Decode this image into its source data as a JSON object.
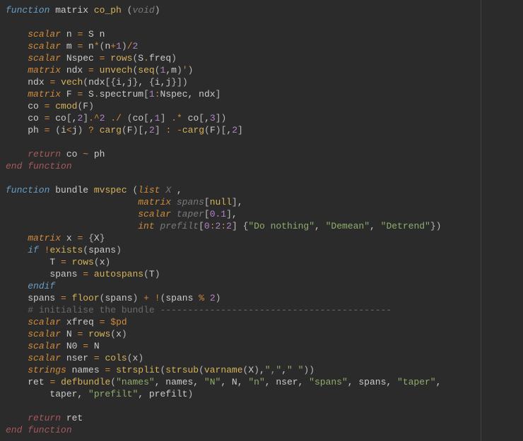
{
  "code": {
    "lines": [
      [
        [
          "kw-blue",
          "function"
        ],
        [
          "ident",
          " matrix "
        ],
        [
          "fn-name",
          "co_ph"
        ],
        [
          "ident",
          " "
        ],
        [
          "paren",
          "("
        ],
        [
          "void",
          "void"
        ],
        [
          "paren",
          ")"
        ]
      ],
      [],
      [
        [
          "ws",
          "    "
        ],
        [
          "type",
          "scalar"
        ],
        [
          "ident",
          " n "
        ],
        [
          "op-eq",
          "="
        ],
        [
          "ident",
          " S n"
        ]
      ],
      [
        [
          "ws",
          "    "
        ],
        [
          "type",
          "scalar"
        ],
        [
          "ident",
          " m "
        ],
        [
          "op-eq",
          "="
        ],
        [
          "ident",
          " n"
        ],
        [
          "op-dot",
          "*"
        ],
        [
          "paren",
          "("
        ],
        [
          "ident",
          "n"
        ],
        [
          "op-dot",
          "+"
        ],
        [
          "num",
          "1"
        ],
        [
          "paren",
          ")"
        ],
        [
          "op-dot",
          "/"
        ],
        [
          "num",
          "2"
        ]
      ],
      [
        [
          "ws",
          "    "
        ],
        [
          "type",
          "scalar"
        ],
        [
          "ident",
          " Nspec "
        ],
        [
          "op-eq",
          "="
        ],
        [
          "ident",
          " "
        ],
        [
          "call",
          "rows"
        ],
        [
          "paren",
          "("
        ],
        [
          "ident",
          "S"
        ],
        [
          "op-dot",
          "."
        ],
        [
          "prop",
          "freq"
        ],
        [
          "paren",
          ")"
        ]
      ],
      [
        [
          "ws",
          "    "
        ],
        [
          "type",
          "matrix"
        ],
        [
          "ident",
          " ndx "
        ],
        [
          "op-eq",
          "="
        ],
        [
          "ident",
          " "
        ],
        [
          "call",
          "unvech"
        ],
        [
          "paren",
          "("
        ],
        [
          "call",
          "seq"
        ],
        [
          "paren",
          "("
        ],
        [
          "num",
          "1"
        ],
        [
          "ident",
          ","
        ],
        [
          "ident",
          "m"
        ],
        [
          "paren",
          ")"
        ],
        [
          "op-dot",
          "'"
        ],
        [
          "paren",
          ")"
        ]
      ],
      [
        [
          "ws",
          "    "
        ],
        [
          "ident",
          "ndx "
        ],
        [
          "op-eq",
          "="
        ],
        [
          "ident",
          " "
        ],
        [
          "call",
          "vech"
        ],
        [
          "paren",
          "("
        ],
        [
          "ident",
          "ndx"
        ],
        [
          "brkt",
          "["
        ],
        [
          "brace",
          "{"
        ],
        [
          "ident",
          "i"
        ],
        [
          "ident",
          ","
        ],
        [
          "ident",
          "j"
        ],
        [
          "brace",
          "}"
        ],
        [
          "ident",
          ", "
        ],
        [
          "brace",
          "{"
        ],
        [
          "ident",
          "i"
        ],
        [
          "ident",
          ","
        ],
        [
          "ident",
          "j"
        ],
        [
          "brace",
          "}"
        ],
        [
          "brkt",
          "]"
        ],
        [
          "paren",
          ")"
        ]
      ],
      [
        [
          "ws",
          "    "
        ],
        [
          "type",
          "matrix"
        ],
        [
          "ident",
          " F "
        ],
        [
          "op-eq",
          "="
        ],
        [
          "ident",
          " S"
        ],
        [
          "op-dot",
          "."
        ],
        [
          "prop",
          "spectrum"
        ],
        [
          "brkt",
          "["
        ],
        [
          "num",
          "1"
        ],
        [
          "op-dot",
          ":"
        ],
        [
          "ident",
          "Nspec"
        ],
        [
          "ident",
          ", ndx"
        ],
        [
          "brkt",
          "]"
        ]
      ],
      [
        [
          "ws",
          "    "
        ],
        [
          "ident",
          "co "
        ],
        [
          "op-eq",
          "="
        ],
        [
          "ident",
          " "
        ],
        [
          "call",
          "cmod"
        ],
        [
          "paren",
          "("
        ],
        [
          "ident",
          "F"
        ],
        [
          "paren",
          ")"
        ]
      ],
      [
        [
          "ws",
          "    "
        ],
        [
          "ident",
          "co "
        ],
        [
          "op-eq",
          "="
        ],
        [
          "ident",
          " co"
        ],
        [
          "brkt",
          "["
        ],
        [
          "ident",
          ","
        ],
        [
          "num",
          "2"
        ],
        [
          "brkt",
          "]"
        ],
        [
          "op-dot",
          ".^"
        ],
        [
          "num",
          "2"
        ],
        [
          "ident",
          " "
        ],
        [
          "op-dot",
          "./"
        ],
        [
          "ident",
          " "
        ],
        [
          "paren",
          "("
        ],
        [
          "ident",
          "co"
        ],
        [
          "brkt",
          "["
        ],
        [
          "ident",
          ","
        ],
        [
          "num",
          "1"
        ],
        [
          "brkt",
          "]"
        ],
        [
          "ident",
          " "
        ],
        [
          "op-dot",
          ".*"
        ],
        [
          "ident",
          " co"
        ],
        [
          "brkt",
          "["
        ],
        [
          "ident",
          ","
        ],
        [
          "num",
          "3"
        ],
        [
          "brkt",
          "]"
        ],
        [
          "paren",
          ")"
        ]
      ],
      [
        [
          "ws",
          "    "
        ],
        [
          "ident",
          "ph "
        ],
        [
          "op-eq",
          "="
        ],
        [
          "ident",
          " "
        ],
        [
          "paren",
          "("
        ],
        [
          "ident",
          "i"
        ],
        [
          "op-dot",
          "<"
        ],
        [
          "ident",
          "j"
        ],
        [
          "paren",
          ")"
        ],
        [
          "ident",
          " "
        ],
        [
          "op-dot",
          "?"
        ],
        [
          "ident",
          " "
        ],
        [
          "call",
          "carg"
        ],
        [
          "paren",
          "("
        ],
        [
          "ident",
          "F"
        ],
        [
          "paren",
          ")"
        ],
        [
          "brkt",
          "["
        ],
        [
          "ident",
          ","
        ],
        [
          "num",
          "2"
        ],
        [
          "brkt",
          "]"
        ],
        [
          "ident",
          " "
        ],
        [
          "op-dot",
          ":"
        ],
        [
          "ident",
          " "
        ],
        [
          "op-dot",
          "-"
        ],
        [
          "call",
          "carg"
        ],
        [
          "paren",
          "("
        ],
        [
          "ident",
          "F"
        ],
        [
          "paren",
          ")"
        ],
        [
          "brkt",
          "["
        ],
        [
          "ident",
          ","
        ],
        [
          "num",
          "2"
        ],
        [
          "brkt",
          "]"
        ]
      ],
      [],
      [
        [
          "ws",
          "    "
        ],
        [
          "kw-retend",
          "return"
        ],
        [
          "ident",
          " co "
        ],
        [
          "op-dot",
          "~"
        ],
        [
          "ident",
          " ph"
        ]
      ],
      [
        [
          "kw-retend",
          "end function"
        ]
      ],
      [],
      [
        [
          "kw-blue",
          "function"
        ],
        [
          "ident",
          " bundle "
        ],
        [
          "fn-name",
          "mvspec"
        ],
        [
          "ident",
          " "
        ],
        [
          "paren",
          "("
        ],
        [
          "type",
          "list"
        ],
        [
          "ident",
          " "
        ],
        [
          "void",
          "X"
        ],
        [
          "ident",
          " ,"
        ]
      ],
      [
        [
          "ws",
          "                        "
        ],
        [
          "type",
          "matrix"
        ],
        [
          "ident",
          " "
        ],
        [
          "void",
          "spans"
        ],
        [
          "brkt",
          "["
        ],
        [
          "fn-name",
          "null"
        ],
        [
          "brkt",
          "]"
        ],
        [
          "ident",
          ","
        ]
      ],
      [
        [
          "ws",
          "                        "
        ],
        [
          "type",
          "scalar"
        ],
        [
          "ident",
          " "
        ],
        [
          "void",
          "taper"
        ],
        [
          "brkt",
          "["
        ],
        [
          "num",
          "0.1"
        ],
        [
          "brkt",
          "]"
        ],
        [
          "ident",
          ","
        ]
      ],
      [
        [
          "ws",
          "                        "
        ],
        [
          "type",
          "int"
        ],
        [
          "ident",
          " "
        ],
        [
          "void",
          "prefilt"
        ],
        [
          "brkt",
          "["
        ],
        [
          "num",
          "0"
        ],
        [
          "op-dot",
          ":"
        ],
        [
          "num",
          "2"
        ],
        [
          "op-dot",
          ":"
        ],
        [
          "num",
          "2"
        ],
        [
          "brkt",
          "]"
        ],
        [
          "ident",
          " "
        ],
        [
          "brace",
          "{"
        ],
        [
          "str",
          "\"Do nothing\""
        ],
        [
          "ident",
          ", "
        ],
        [
          "str",
          "\"Demean\""
        ],
        [
          "ident",
          ", "
        ],
        [
          "str",
          "\"Detrend\""
        ],
        [
          "brace",
          "}"
        ],
        [
          "paren",
          ")"
        ]
      ],
      [
        [
          "ws",
          "    "
        ],
        [
          "type",
          "matrix"
        ],
        [
          "ident",
          " x "
        ],
        [
          "op-eq",
          "="
        ],
        [
          "ident",
          " "
        ],
        [
          "brace",
          "{"
        ],
        [
          "ident",
          "X"
        ],
        [
          "brace",
          "}"
        ]
      ],
      [
        [
          "ws",
          "    "
        ],
        [
          "kw-blue",
          "if"
        ],
        [
          "ident",
          " "
        ],
        [
          "op-dot",
          "!"
        ],
        [
          "call",
          "exists"
        ],
        [
          "paren",
          "("
        ],
        [
          "ident",
          "spans"
        ],
        [
          "paren",
          ")"
        ]
      ],
      [
        [
          "ws",
          "        "
        ],
        [
          "ident",
          "T "
        ],
        [
          "op-eq",
          "="
        ],
        [
          "ident",
          " "
        ],
        [
          "call",
          "rows"
        ],
        [
          "paren",
          "("
        ],
        [
          "ident",
          "x"
        ],
        [
          "paren",
          ")"
        ]
      ],
      [
        [
          "ws",
          "        "
        ],
        [
          "ident",
          "spans "
        ],
        [
          "op-eq",
          "="
        ],
        [
          "ident",
          " "
        ],
        [
          "call",
          "autospans"
        ],
        [
          "paren",
          "("
        ],
        [
          "ident",
          "T"
        ],
        [
          "paren",
          ")"
        ]
      ],
      [
        [
          "ws",
          "    "
        ],
        [
          "kw-blue",
          "endif"
        ]
      ],
      [
        [
          "ws",
          "    "
        ],
        [
          "ident",
          "spans "
        ],
        [
          "op-eq",
          "="
        ],
        [
          "ident",
          " "
        ],
        [
          "call",
          "floor"
        ],
        [
          "paren",
          "("
        ],
        [
          "ident",
          "spans"
        ],
        [
          "paren",
          ")"
        ],
        [
          "ident",
          " "
        ],
        [
          "op-dot",
          "+"
        ],
        [
          "ident",
          " "
        ],
        [
          "op-dot",
          "!"
        ],
        [
          "paren",
          "("
        ],
        [
          "ident",
          "spans "
        ],
        [
          "op-dot",
          "%"
        ],
        [
          "ident",
          " "
        ],
        [
          "num",
          "2"
        ],
        [
          "paren",
          ")"
        ]
      ],
      [
        [
          "ws",
          "    "
        ],
        [
          "comment",
          "# initialise the bundle ------------------------------------------"
        ]
      ],
      [
        [
          "ws",
          "    "
        ],
        [
          "type",
          "scalar"
        ],
        [
          "ident",
          " xfreq "
        ],
        [
          "op-eq",
          "="
        ],
        [
          "ident",
          " "
        ],
        [
          "dollar",
          "$pd"
        ]
      ],
      [
        [
          "ws",
          "    "
        ],
        [
          "type",
          "scalar"
        ],
        [
          "ident",
          " N "
        ],
        [
          "op-eq",
          "="
        ],
        [
          "ident",
          " "
        ],
        [
          "call",
          "rows"
        ],
        [
          "paren",
          "("
        ],
        [
          "ident",
          "x"
        ],
        [
          "paren",
          ")"
        ]
      ],
      [
        [
          "ws",
          "    "
        ],
        [
          "type",
          "scalar"
        ],
        [
          "ident",
          " N0 "
        ],
        [
          "op-eq",
          "="
        ],
        [
          "ident",
          " N"
        ]
      ],
      [
        [
          "ws",
          "    "
        ],
        [
          "type",
          "scalar"
        ],
        [
          "ident",
          " nser "
        ],
        [
          "op-eq",
          "="
        ],
        [
          "ident",
          " "
        ],
        [
          "call",
          "cols"
        ],
        [
          "paren",
          "("
        ],
        [
          "ident",
          "x"
        ],
        [
          "paren",
          ")"
        ]
      ],
      [
        [
          "ws",
          "    "
        ],
        [
          "type",
          "strings"
        ],
        [
          "ident",
          " names "
        ],
        [
          "op-eq",
          "="
        ],
        [
          "ident",
          " "
        ],
        [
          "call",
          "strsplit"
        ],
        [
          "paren",
          "("
        ],
        [
          "call",
          "strsub"
        ],
        [
          "paren",
          "("
        ],
        [
          "call",
          "varname"
        ],
        [
          "paren",
          "("
        ],
        [
          "ident",
          "X"
        ],
        [
          "paren",
          ")"
        ],
        [
          "ident",
          ","
        ],
        [
          "str",
          "\",\""
        ],
        [
          "ident",
          ","
        ],
        [
          "str",
          "\" \""
        ],
        [
          "paren",
          "))"
        ]
      ],
      [
        [
          "ws",
          "    "
        ],
        [
          "ident",
          "ret "
        ],
        [
          "op-eq",
          "="
        ],
        [
          "ident",
          " "
        ],
        [
          "call",
          "defbundle"
        ],
        [
          "paren",
          "("
        ],
        [
          "str",
          "\"names\""
        ],
        [
          "ident",
          ", names, "
        ],
        [
          "str",
          "\"N\""
        ],
        [
          "ident",
          ", N, "
        ],
        [
          "str",
          "\"n\""
        ],
        [
          "ident",
          ", nser, "
        ],
        [
          "str",
          "\"spans\""
        ],
        [
          "ident",
          ", spans, "
        ],
        [
          "str",
          "\"taper\""
        ],
        [
          "ident",
          ","
        ]
      ],
      [
        [
          "ws",
          "        "
        ],
        [
          "ident",
          "taper, "
        ],
        [
          "str",
          "\"prefilt\""
        ],
        [
          "ident",
          ", prefilt"
        ],
        [
          "paren",
          ")"
        ]
      ],
      [],
      [
        [
          "ws",
          "    "
        ],
        [
          "kw-retend",
          "return"
        ],
        [
          "ident",
          " ret"
        ]
      ],
      [
        [
          "kw-retend",
          "end function"
        ]
      ]
    ]
  }
}
